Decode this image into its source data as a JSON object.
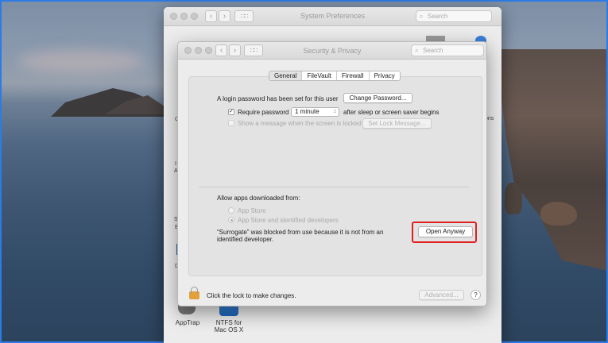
{
  "system_preferences": {
    "title": "System Preferences",
    "search_placeholder": "Search",
    "fragments": {
      "left_c": "C",
      "left_i": "I",
      "left_a": "A",
      "left_s": "S",
      "left_e": "E",
      "left_d": "D",
      "right_ons": "ons"
    },
    "apps": [
      {
        "label": "AppTrap",
        "icon": "apptrap-icon"
      },
      {
        "label": "NTFS for\nMac OS X",
        "icon": "ntfs-icon"
      }
    ]
  },
  "security_dialog": {
    "title": "Security & Privacy",
    "search_placeholder": "Search",
    "tabs": [
      "General",
      "FileVault",
      "Firewall",
      "Privacy"
    ],
    "active_tab": "General",
    "login_password_text": "A login password has been set for this user",
    "change_password_label": "Change Password...",
    "require_password_label": "Require password",
    "require_password_checked": true,
    "require_password_delay": "1 minute",
    "after_sleep_text": "after sleep or screen saver begins",
    "show_message_label": "Show a message when the screen is locked",
    "show_message_checked": false,
    "set_lock_message_label": "Set Lock Message...",
    "allow_apps_label": "Allow apps downloaded from:",
    "radio_app_store": "App Store",
    "radio_identified": "App Store and identified developers",
    "selected_radio": "App Store and identified developers",
    "blocked_message_line1": "“Surrogate” was blocked from use because it is not from an",
    "blocked_message_line2": "identified developer.",
    "open_anyway_label": "Open Anyway",
    "lock_text": "Click the lock to make changes.",
    "advanced_label": "Advanced...",
    "help_label": "?"
  },
  "icons": {
    "back": "‹",
    "forward": "›",
    "grid": "∷∷",
    "search": "⌕",
    "checkmark": "✓",
    "select_arrows": "↕"
  },
  "colors": {
    "highlight_border": "#e02020",
    "lock_body": "#e3a13a",
    "frame_border": "#2d7be5"
  }
}
